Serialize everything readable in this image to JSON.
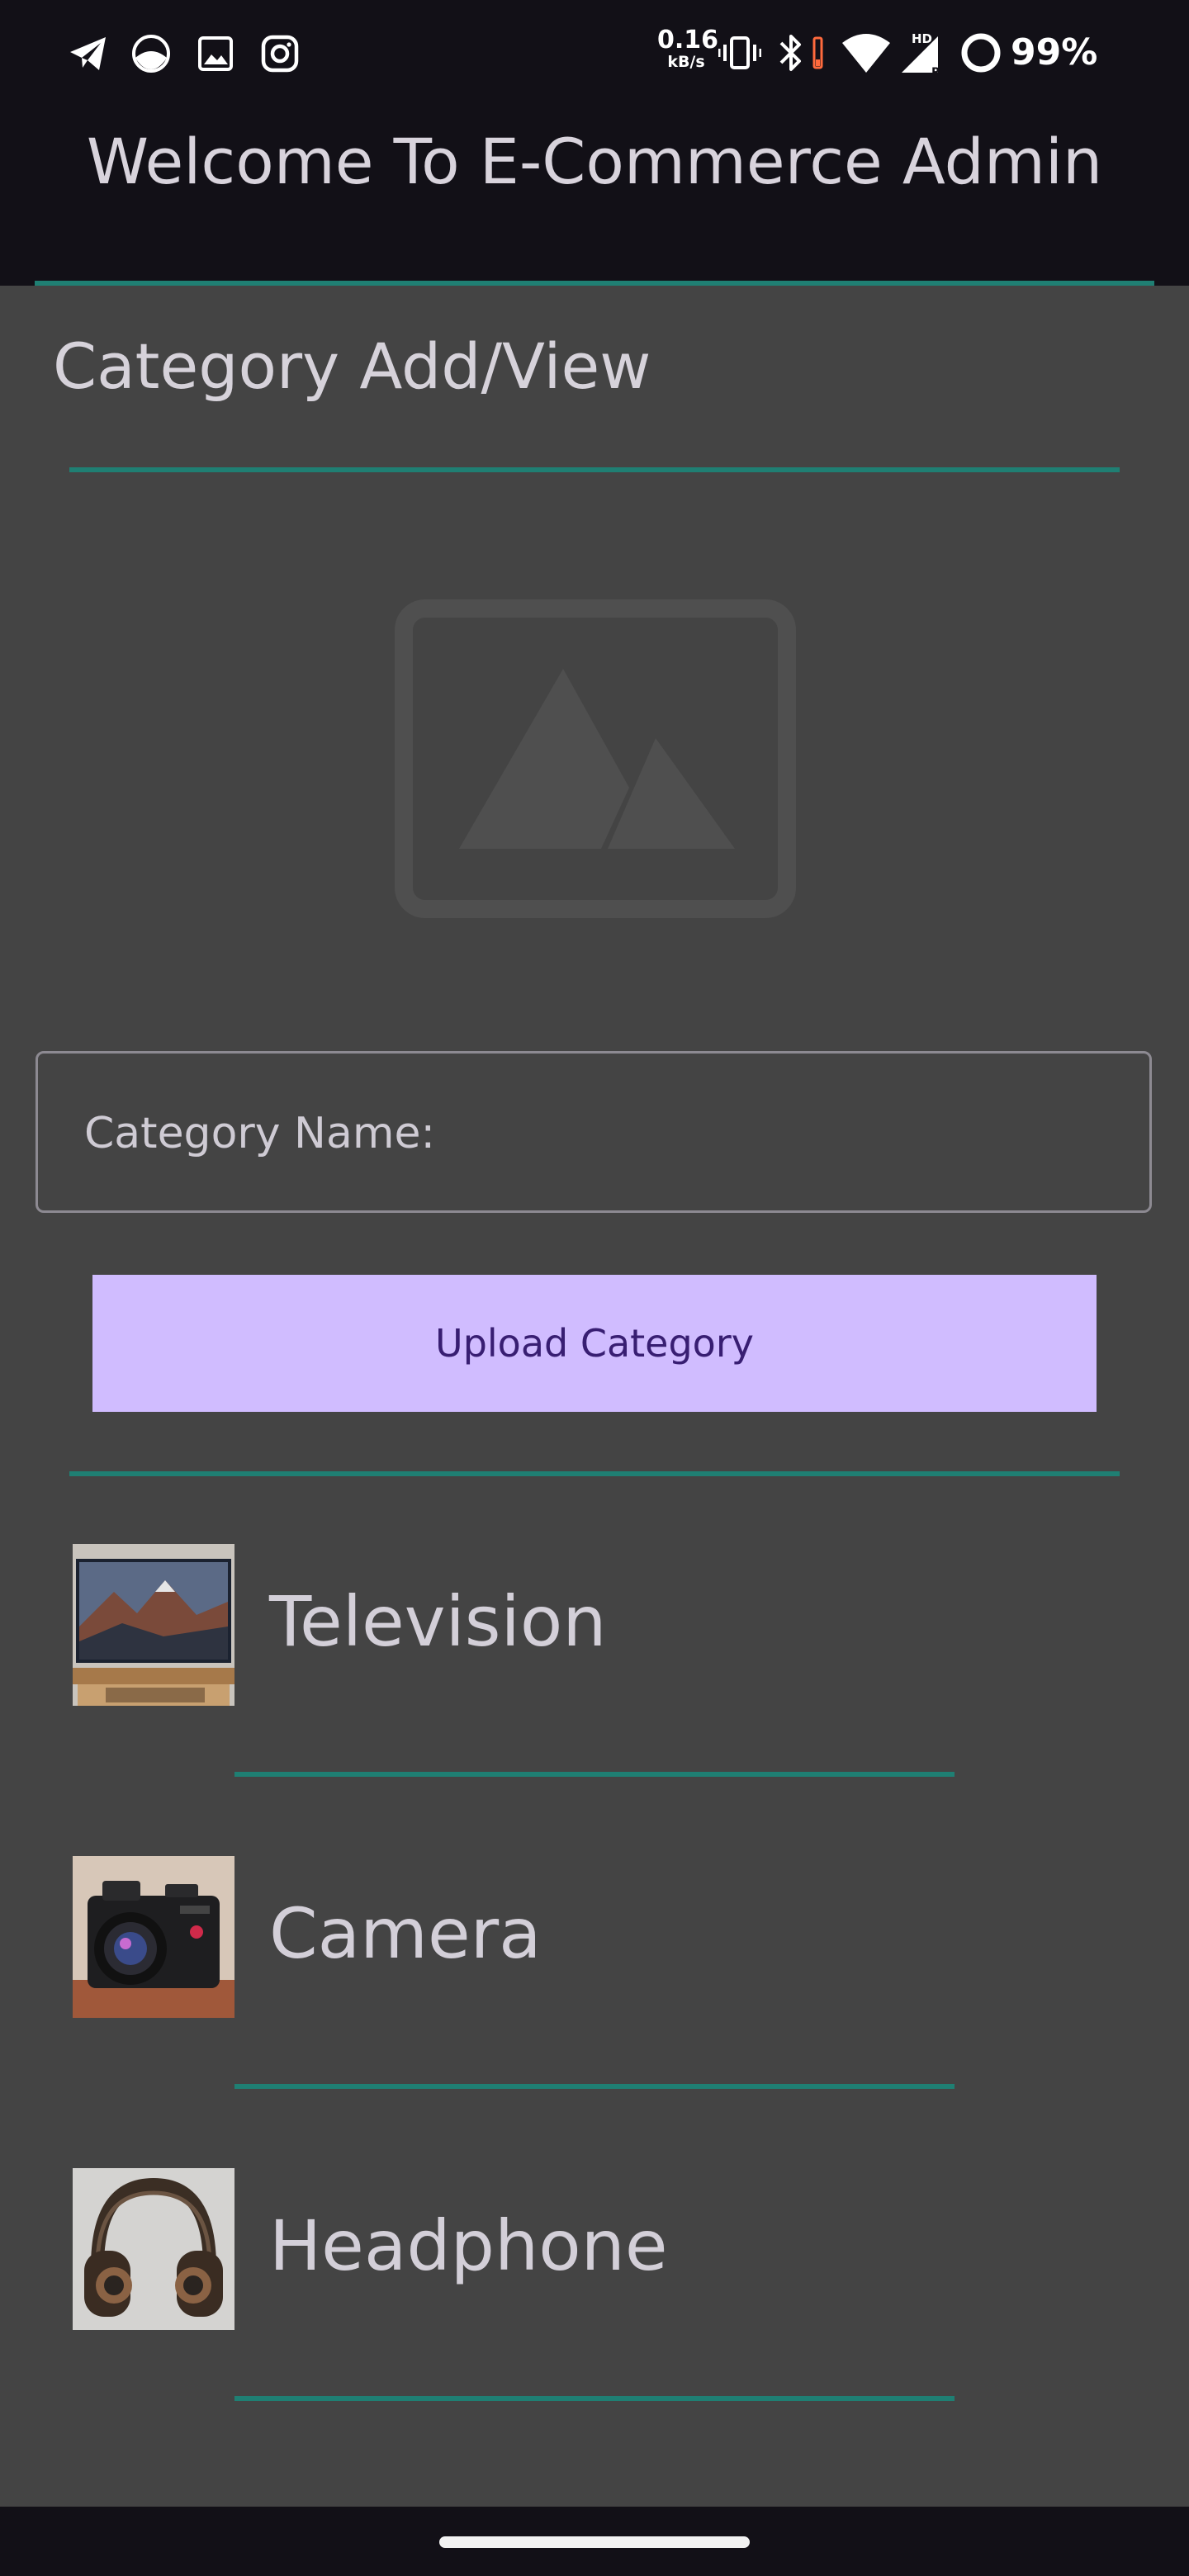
{
  "status_bar": {
    "net_speed_value": "0.16",
    "net_speed_unit": "kB/s",
    "hd_label": "HD",
    "roaming_label": "R",
    "battery": "99%",
    "notification_icons": [
      "telegram-icon",
      "gallery-icon",
      "image-icon",
      "instagram-icon"
    ],
    "system_icons": [
      "vibrate-icon",
      "bluetooth-icon",
      "wifi-icon",
      "signal-icon",
      "battery-icon"
    ]
  },
  "header": {
    "title": "Welcome To E-Commerce Admin"
  },
  "section": {
    "title": "Category Add/View"
  },
  "form": {
    "image_placeholder_icon": "image-placeholder-icon",
    "name_label": "Category Name:",
    "upload_label": "Upload Category"
  },
  "categories": [
    {
      "name": "Television",
      "thumbnail": "television-thumbnail"
    },
    {
      "name": "Camera",
      "thumbnail": "camera-thumbnail"
    },
    {
      "name": "Headphone",
      "thumbnail": "headphone-thumbnail"
    }
  ],
  "colors": {
    "background": "#444444",
    "app_bar": "#121017",
    "accent_line": "#1f7f73",
    "button_bg": "#d0bcff",
    "button_text": "#381e72",
    "text": "#d6d2da"
  }
}
